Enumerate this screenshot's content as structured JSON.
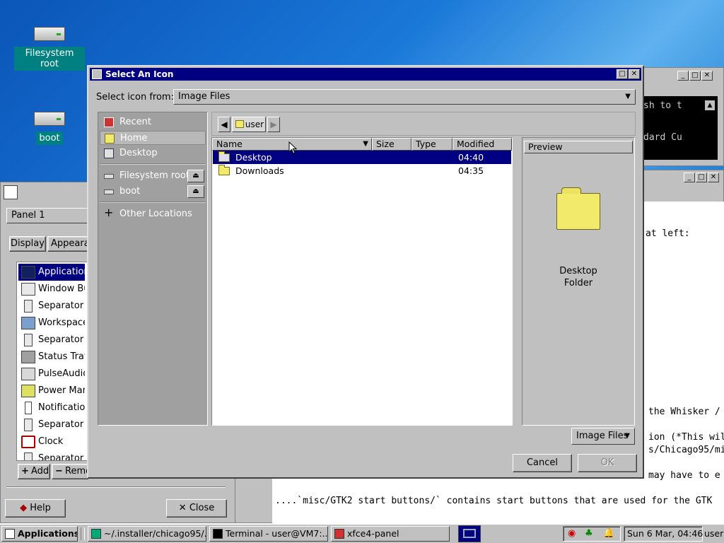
{
  "desktop": {
    "icons": [
      {
        "label": "Filesystem root"
      },
      {
        "label": "boot"
      }
    ]
  },
  "terminal_window": {
    "lines": [
      "sh to t",
      "dard Cu"
    ],
    "scroll_arrow": "▲"
  },
  "doc_window": {
    "lines": [
      "at left:",
      "the Whisker /",
      "ion (*This wil",
      "s/Chicago95/mi",
      "may have to e",
      "....`misc/GTK2 start buttons/` contains start buttons that are used for the GTK"
    ]
  },
  "panel_prefs": {
    "panel_select": "Panel 1",
    "tabs": [
      "Display",
      "Appearan"
    ],
    "items": [
      {
        "label": "Applications",
        "icon": "applications-icon"
      },
      {
        "label": "Window Butt",
        "icon": "window-buttons-icon"
      },
      {
        "label": "Separator",
        "icon": "separator-icon"
      },
      {
        "label": "Workspace",
        "icon": "workspace-icon"
      },
      {
        "label": "Separator",
        "icon": "separator-icon"
      },
      {
        "label": "Status Tray",
        "icon": "status-tray-icon"
      },
      {
        "label": "PulseAudio",
        "icon": "pulseaudio-icon"
      },
      {
        "label": "Power Mana",
        "icon": "power-manager-icon"
      },
      {
        "label": "Notification",
        "icon": "notification-icon"
      },
      {
        "label": "Separator",
        "icon": "separator-icon"
      },
      {
        "label": "Clock",
        "icon": "clock-icon"
      },
      {
        "label": "Separator",
        "icon": "separator-icon"
      }
    ],
    "add_label": "Add",
    "remove_label": "Remo",
    "help_label": "Help",
    "close_label": "Close"
  },
  "dialog": {
    "title": "Select An Icon",
    "select_from_label": "Select icon from:",
    "select_from_value": "Image Files",
    "places": {
      "recent": "Recent",
      "home": "Home",
      "desktop": "Desktop",
      "filesystem_root": "Filesystem root",
      "boot": "boot",
      "other_locations": "Other Locations"
    },
    "path": {
      "current": "user"
    },
    "columns": {
      "name": "Name",
      "size": "Size",
      "type": "Type",
      "modified": "Modified"
    },
    "files": [
      {
        "name": "Desktop",
        "modified": "04:40",
        "selected": true
      },
      {
        "name": "Downloads",
        "modified": "04:35",
        "selected": false
      }
    ],
    "preview": {
      "title": "Preview",
      "caption_line1": "Desktop",
      "caption_line2": "Folder"
    },
    "filter": "Image Files",
    "cancel_label": "Cancel",
    "ok_label": "OK"
  },
  "taskbar": {
    "start_label": "Applications",
    "tasks": [
      {
        "label": "~/.installer/chicago95/..."
      },
      {
        "label": "Terminal - user@VM7:..."
      },
      {
        "label": "xfce4-panel"
      }
    ],
    "clock": "Sun 6 Mar, 04:46",
    "user": "user"
  }
}
